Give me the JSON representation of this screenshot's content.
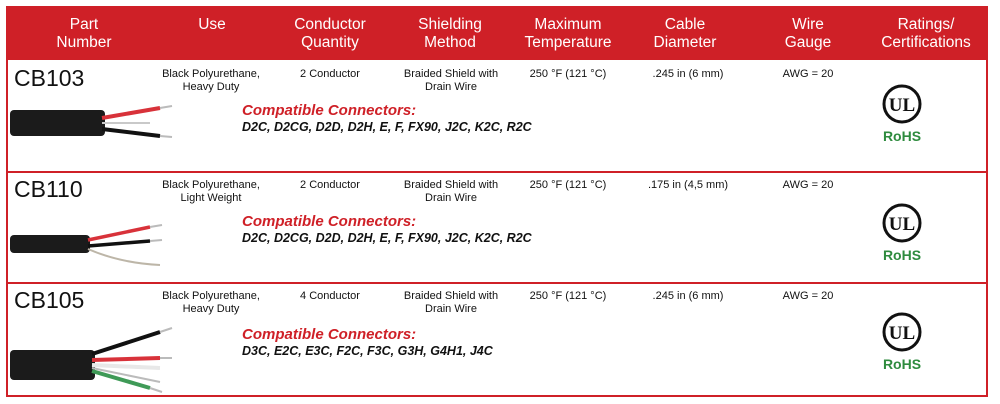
{
  "headers": [
    "Part\nNumber",
    "Use",
    "Conductor\nQuantity",
    "Shielding\nMethod",
    "Maximum\nTemperature",
    "Cable\nDiameter",
    "Wire\nGauge",
    "Ratings/\nCertifications"
  ],
  "rows": [
    {
      "part_number": "CB103",
      "use": "Black Polyurethane,\nHeavy Duty",
      "conductor_quantity": "2 Conductor",
      "shielding": "Braided Shield with\nDrain Wire",
      "max_temperature": "250 °F  (121 °C)",
      "diameter": ".245 in (6 mm)",
      "gauge": "AWG = 20",
      "compatible_title": "Compatible Connectors:",
      "compatible_list": "D2C, D2CG, D2D, D2H, E, F, FX90, J2C, K2C, R2C",
      "cert_logo": "UL",
      "cert_text": "RoHS"
    },
    {
      "part_number": "CB110",
      "use": "Black Polyurethane,\nLight Weight",
      "conductor_quantity": "2 Conductor",
      "shielding": "Braided Shield with\nDrain Wire",
      "max_temperature": "250 °F  (121 °C)",
      "diameter": ".175 in (4,5 mm)",
      "gauge": "AWG = 20",
      "compatible_title": "Compatible Connectors:",
      "compatible_list": "D2C, D2CG, D2D, D2H, E, F, FX90, J2C, K2C, R2C",
      "cert_logo": "UL",
      "cert_text": "RoHS"
    },
    {
      "part_number": "CB105",
      "use": "Black Polyurethane,\nHeavy Duty",
      "conductor_quantity": "4 Conductor",
      "shielding": "Braided Shield with\nDrain Wire",
      "max_temperature": "250 °F  (121 °C)",
      "diameter": ".245 in (6 mm)",
      "gauge": "AWG = 20",
      "compatible_title": "Compatible Connectors:",
      "compatible_list": "D3C, E2C, E3C, F2C, F3C, G3H, G4H1, J4C",
      "cert_logo": "UL",
      "cert_text": "RoHS"
    }
  ],
  "icons": {
    "cable_image": "cable-photo-icon",
    "ul_logo": "ul-certification-icon"
  },
  "colors": {
    "accent": "#cf2027",
    "rohs": "#2e8b3e",
    "text": "#111111",
    "white": "#ffffff"
  }
}
